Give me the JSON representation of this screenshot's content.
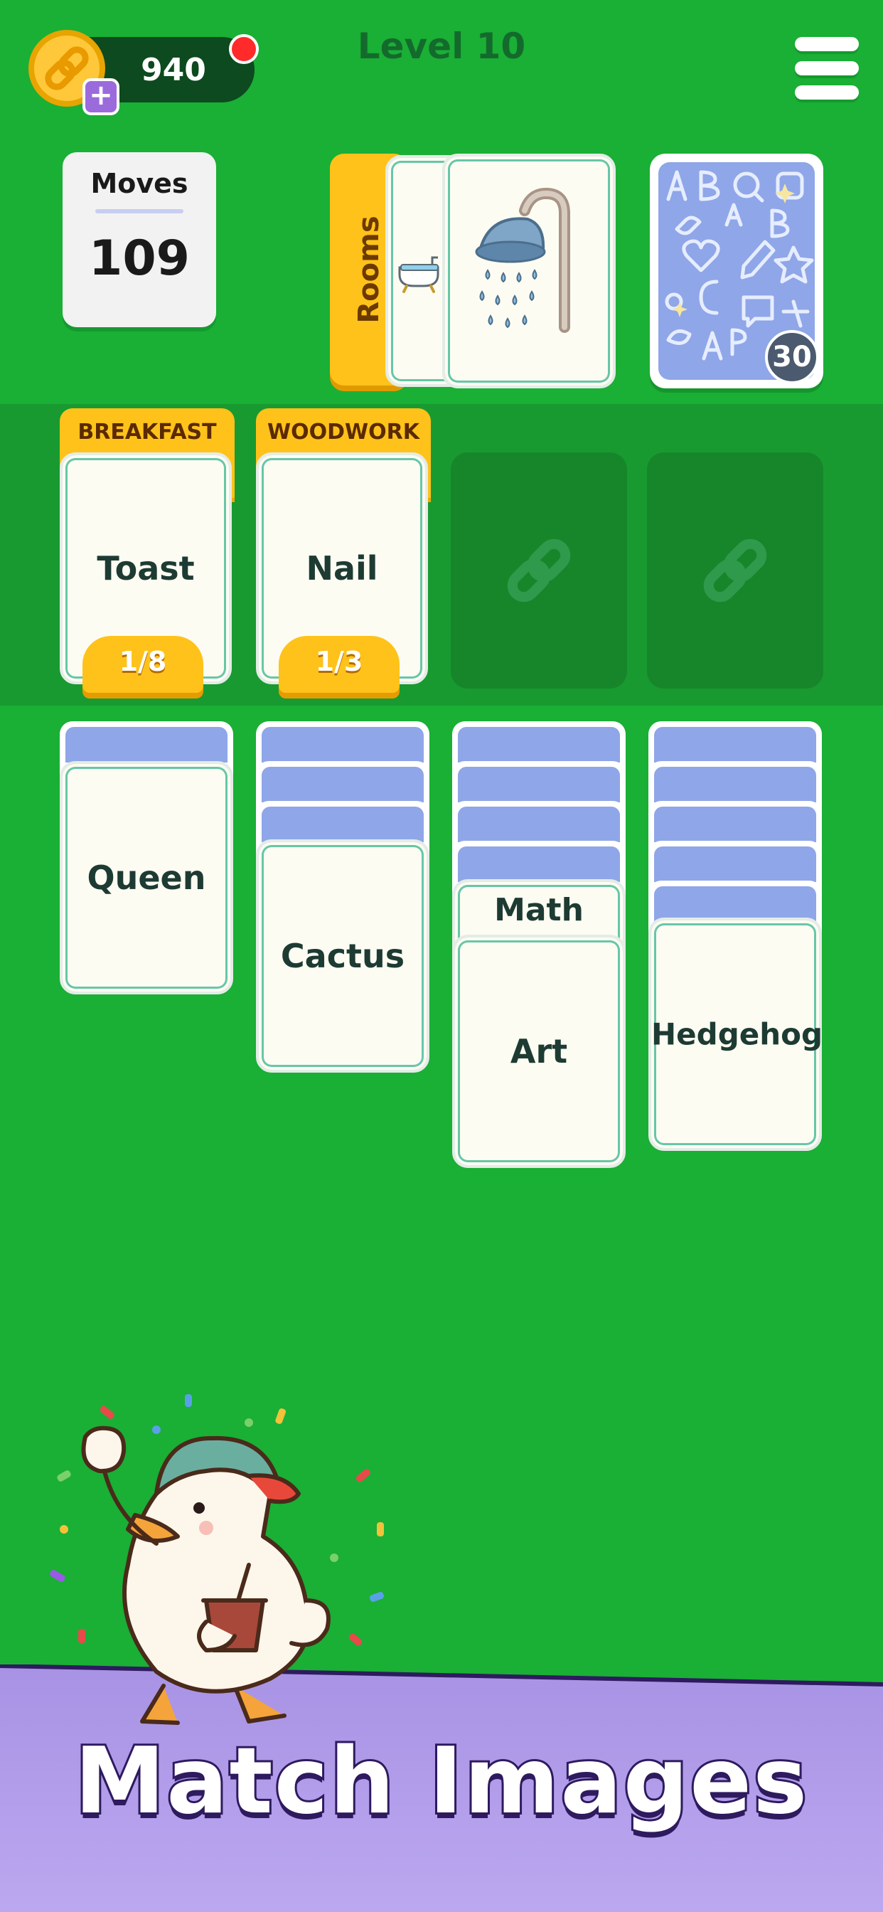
{
  "header": {
    "coins": "940",
    "level_title": "Level 10"
  },
  "moves": {
    "label": "Moves",
    "value": "109"
  },
  "category_pile": {
    "label": "Rooms"
  },
  "deck": {
    "remaining": "30"
  },
  "foundations": [
    {
      "category": "BREAKFAST",
      "card": "Toast",
      "progress": "1/8"
    },
    {
      "category": "WOODWORK",
      "card": "Nail",
      "progress": "1/3"
    }
  ],
  "tableau": {
    "col1": {
      "top_card": "Queen"
    },
    "col2": {
      "top_card": "Cactus"
    },
    "col3": {
      "partial_card": "Math",
      "top_card": "Art"
    },
    "col4": {
      "top_card": "Hedgehog"
    }
  },
  "banner": {
    "title": "Match Images"
  },
  "colors": {
    "background": "#1aaf35",
    "foundation_band": "#189a30",
    "category_yellow": "#ffc21a",
    "card_back_blue": "#8fa6e8",
    "banner_purple": "#b4a2ea"
  },
  "icons": [
    "chain-coin-icon",
    "plus-icon",
    "notification-dot-icon",
    "menu-icon",
    "bathtub-icon",
    "shower-icon",
    "chain-link-icon",
    "duck-mascot"
  ]
}
